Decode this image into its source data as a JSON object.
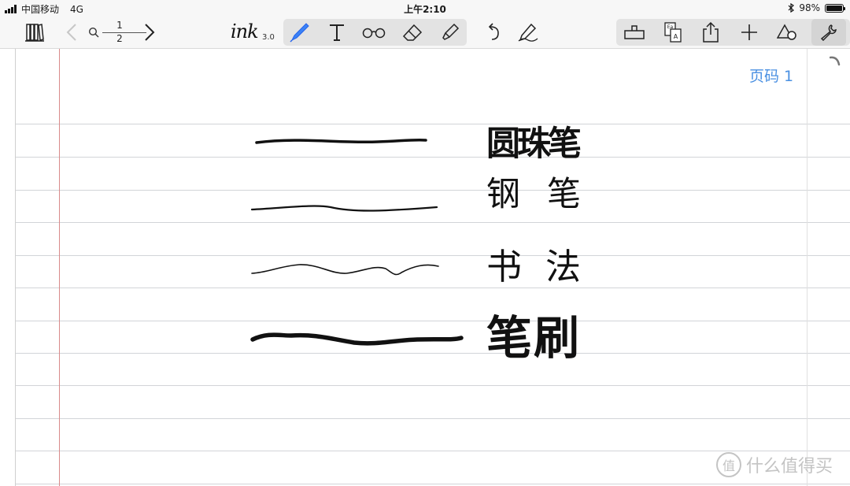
{
  "status_bar": {
    "carrier": "中国移动",
    "network": "4G",
    "time": "上午2:10",
    "battery_percent": "98%",
    "battery_level": 0.98
  },
  "toolbar": {
    "page_current": "1",
    "page_total": "2",
    "app_logo": "ink",
    "app_version": "3.0",
    "icons": [
      "library-icon",
      "back-icon",
      "search-icon",
      "forward-icon",
      "pen-icon",
      "text-icon",
      "glasses-icon",
      "eraser-icon",
      "highlighter-icon",
      "undo-icon",
      "pen-settings-icon",
      "ruler-icon",
      "translate-icon",
      "share-icon",
      "add-icon",
      "shapes-icon",
      "wrench-icon"
    ]
  },
  "page": {
    "label": "页码 1",
    "handwriting": [
      "圆珠笔",
      "钢笔",
      "书法",
      "笔刷"
    ]
  },
  "watermark": {
    "icon_glyph": "值",
    "text": "什么值得买"
  },
  "colors": {
    "accent": "#3b82f6",
    "page_label": "#4a90e2",
    "margin_line": "#d98a8a",
    "rule_line": "#d2d4d8"
  }
}
